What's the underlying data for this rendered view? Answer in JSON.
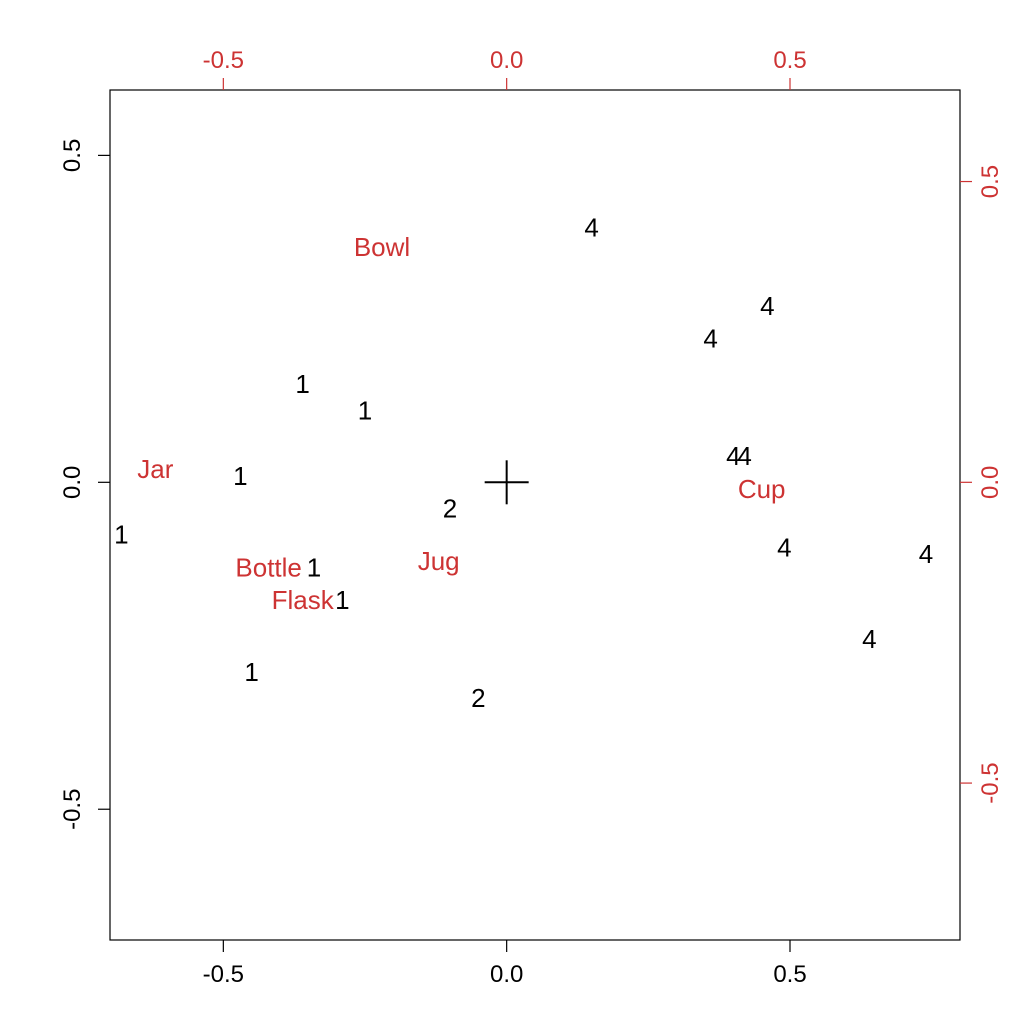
{
  "chart_data": {
    "type": "scatter",
    "title": "",
    "xlabel": "",
    "ylabel": "",
    "xlim_bottom": [
      -0.7,
      0.8
    ],
    "ylim_left": [
      -0.7,
      0.6
    ],
    "xlim_top": [
      -0.7,
      0.8
    ],
    "ylim_right": [
      -0.7,
      0.6
    ],
    "bottom_ticks": [
      {
        "x": -0.5,
        "label": "-0.5"
      },
      {
        "x": 0.0,
        "label": "0.0"
      },
      {
        "x": 0.5,
        "label": "0.5"
      }
    ],
    "left_ticks": [
      {
        "y": -0.5,
        "label": "-0.5"
      },
      {
        "y": 0.0,
        "label": "0.0"
      },
      {
        "y": 0.5,
        "label": "0.5"
      }
    ],
    "top_ticks": [
      {
        "x": -0.5,
        "label": "-0.5"
      },
      {
        "x": 0.0,
        "label": "0.0"
      },
      {
        "x": 0.5,
        "label": "0.5"
      }
    ],
    "right_ticks": [
      {
        "y": -0.46,
        "label": "-0.5"
      },
      {
        "y": 0.0,
        "label": "0.0"
      },
      {
        "y": 0.46,
        "label": "0.5"
      }
    ],
    "series": [
      {
        "name": "observations",
        "color": "#000000",
        "points": [
          {
            "label": "1",
            "x": -0.68,
            "y": -0.08
          },
          {
            "label": "1",
            "x": -0.47,
            "y": 0.01
          },
          {
            "label": "1",
            "x": -0.36,
            "y": 0.15
          },
          {
            "label": "1",
            "x": -0.25,
            "y": 0.11
          },
          {
            "label": "1",
            "x": -0.34,
            "y": -0.13
          },
          {
            "label": "1",
            "x": -0.29,
            "y": -0.18
          },
          {
            "label": "1",
            "x": -0.45,
            "y": -0.29
          },
          {
            "label": "2",
            "x": -0.1,
            "y": -0.04
          },
          {
            "label": "2",
            "x": -0.05,
            "y": -0.33
          },
          {
            "label": "4",
            "x": 0.15,
            "y": 0.39
          },
          {
            "label": "4",
            "x": 0.36,
            "y": 0.22
          },
          {
            "label": "4",
            "x": 0.46,
            "y": 0.27
          },
          {
            "label": "4",
            "x": 0.4,
            "y": 0.04
          },
          {
            "label": "4",
            "x": 0.42,
            "y": 0.04
          },
          {
            "label": "4",
            "x": 0.49,
            "y": -0.1
          },
          {
            "label": "4",
            "x": 0.64,
            "y": -0.24
          },
          {
            "label": "4",
            "x": 0.74,
            "y": -0.11
          }
        ]
      },
      {
        "name": "variables",
        "color": "#cd3333",
        "points": [
          {
            "label": "Bowl",
            "x": -0.22,
            "y": 0.36
          },
          {
            "label": "Jar",
            "x": -0.62,
            "y": 0.02
          },
          {
            "label": "Bottle",
            "x": -0.42,
            "y": -0.13
          },
          {
            "label": "Flask",
            "x": -0.36,
            "y": -0.18
          },
          {
            "label": "Jug",
            "x": -0.12,
            "y": -0.12
          },
          {
            "label": "Cup",
            "x": 0.45,
            "y": -0.01
          }
        ]
      }
    ],
    "origin_cross": {
      "x": 0.0,
      "y": 0.0
    }
  },
  "colors": {
    "axis_black": "#000000",
    "axis_red": "#cd3333",
    "background": "#ffffff"
  }
}
